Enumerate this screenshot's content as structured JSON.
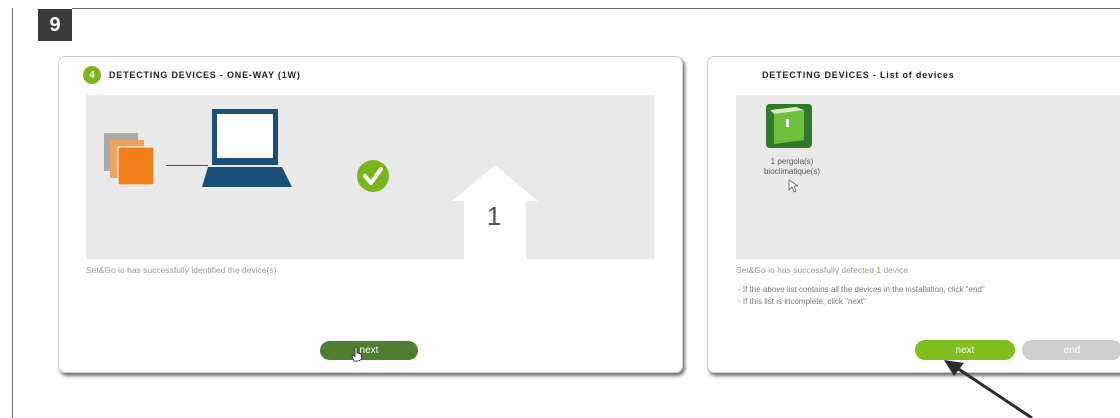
{
  "step_badge": "9",
  "left_panel": {
    "step_number": "4",
    "title": "DETECTING DEVICES - ONE-WAY (1W)",
    "house_count": "1",
    "status": "Set&Go io has successfully identified the device(s)",
    "next_label": "next"
  },
  "right_panel": {
    "title": "DETECTING DEVICES - List of devices",
    "device_line1": "1 pergola(s)",
    "device_line2": "bioclimatique(s)",
    "status_prefix": "Set&Go io has successfully detected ",
    "status_count": "1",
    "status_suffix": " device.",
    "hint1": "- If the above list contains all the devices in the installation, click \"end\"",
    "hint2": "- If this list is incomplete, click \"next\"",
    "next_label": "next",
    "end_label": "end"
  },
  "colors": {
    "accent_green": "#7ab51d",
    "dark_green_button": "#4e7e32",
    "laptop_blue": "#1a4f7a",
    "orange": "#f07f1b"
  },
  "icons": {
    "success": "check-circle-icon",
    "device": "pergola-icon",
    "laptop": "laptop-icon",
    "house": "house-icon",
    "cursor": "mouse-cursor-icon",
    "arrow": "pointer-arrow-icon"
  }
}
